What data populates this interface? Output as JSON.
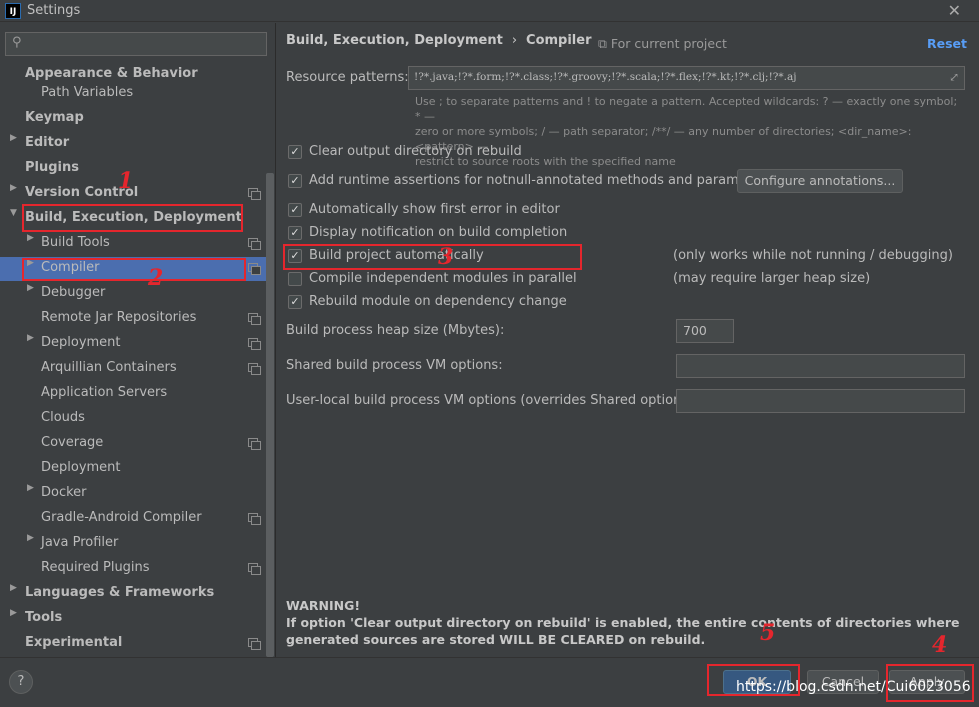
{
  "window": {
    "app_icon": "IJ",
    "title": "Settings",
    "close_icon": "✕"
  },
  "sidebar": {
    "search_placeholder": "",
    "items": [
      {
        "label": "Appearance & Behavior",
        "bold": true
      },
      {
        "label": "Path Variables"
      },
      {
        "label": "Keymap",
        "bold": true
      },
      {
        "label": "Editor",
        "bold": true
      },
      {
        "label": "Plugins",
        "bold": true
      },
      {
        "label": "Version Control",
        "bold": true
      },
      {
        "label": "Build, Execution, Deployment",
        "bold": true
      },
      {
        "label": "Build Tools"
      },
      {
        "label": "Compiler"
      },
      {
        "label": "Debugger"
      },
      {
        "label": "Remote Jar Repositories"
      },
      {
        "label": "Deployment"
      },
      {
        "label": "Arquillian Containers"
      },
      {
        "label": "Application Servers"
      },
      {
        "label": "Clouds"
      },
      {
        "label": "Coverage"
      },
      {
        "label": "Deployment"
      },
      {
        "label": "Docker"
      },
      {
        "label": "Gradle-Android Compiler"
      },
      {
        "label": "Java Profiler"
      },
      {
        "label": "Required Plugins"
      },
      {
        "label": "Languages & Frameworks",
        "bold": true
      },
      {
        "label": "Tools",
        "bold": true
      },
      {
        "label": "Experimental",
        "bold": true
      }
    ]
  },
  "breadcrumb": {
    "parent": "Build, Execution, Deployment",
    "separator": "›",
    "current": "Compiler"
  },
  "for_current_project": "For current project",
  "reset": "Reset",
  "resource_patterns": {
    "label": "Resource patterns:",
    "value": "!?*.java;!?*.form;!?*.class;!?*.groovy;!?*.scala;!?*.flex;!?*.kt;!?*.clj;!?*.aj",
    "hint_lines": [
      "Use ; to separate patterns and ! to negate a pattern. Accepted wildcards: ? — exactly one symbol; * —",
      "zero or more symbols; / — path separator; /**/ — any number of directories; <dir_name>:<pattern> —",
      "restrict to source roots with the specified name"
    ]
  },
  "options": [
    {
      "label": "Clear output directory on rebuild",
      "checked": true
    },
    {
      "label": "Add runtime assertions for notnull-annotated methods and parameters",
      "checked": true
    },
    {
      "label": "Automatically show first error in editor",
      "checked": true
    },
    {
      "label": "Display notification on build completion",
      "checked": true
    },
    {
      "label": "Build project automatically",
      "checked": true
    },
    {
      "label": "Compile independent modules in parallel",
      "checked": false
    },
    {
      "label": "Rebuild module on dependency change",
      "checked": true
    }
  ],
  "configure_annotations": "Configure annotations...",
  "notes": {
    "build_auto": "(only works while not running / debugging)",
    "parallel": "(may require larger heap size)"
  },
  "heap": {
    "label": "Build process heap size (Mbytes):",
    "value": "700"
  },
  "shared_vm": {
    "label": "Shared build process VM options:",
    "value": ""
  },
  "user_vm": {
    "label": "User-local build process VM options (overrides Shared options):",
    "value": ""
  },
  "warning": {
    "title": "WARNING!",
    "text": "If option 'Clear output directory on rebuild' is enabled, the entire contents of directories where generated sources are stored WILL BE CLEARED on rebuild."
  },
  "buttons": {
    "help": "?",
    "ok": "OK",
    "cancel": "Cancel",
    "apply": "Apply"
  },
  "watermark": "https://blog.csdn.net/Cui6023056",
  "annotations": [
    "1",
    "2",
    "3",
    "4",
    "5"
  ],
  "colors": {
    "selection": "#4b6eaf",
    "annotation": "#e5262d",
    "link": "#589df6"
  }
}
